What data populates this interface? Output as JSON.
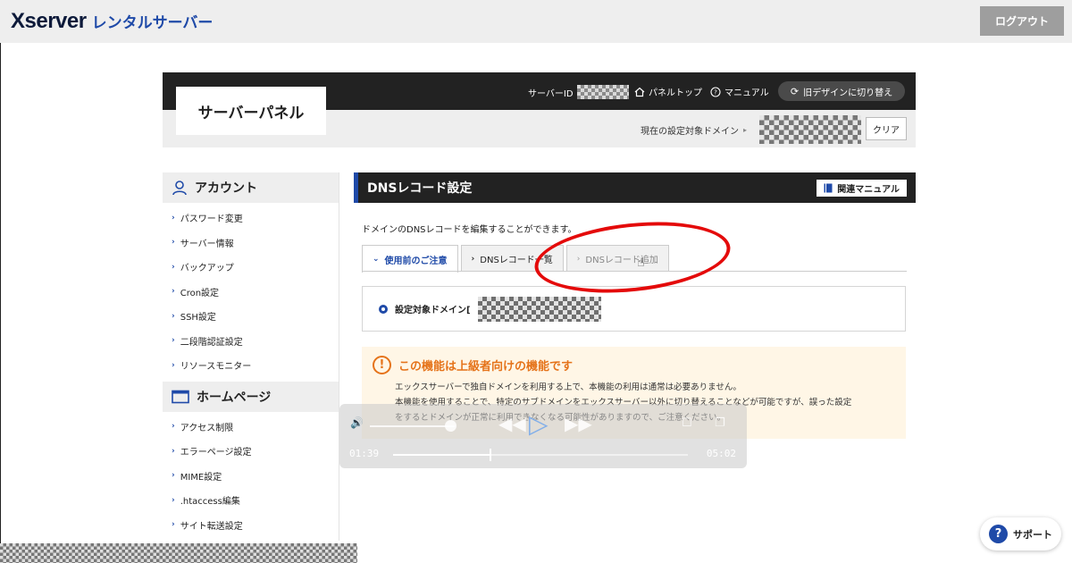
{
  "header": {
    "logo_text": "Xserver",
    "logo_sub": "レンタルサーバー",
    "logout_label": "ログアウト"
  },
  "panel": {
    "title": "サーバーパネル",
    "server_id_label": "サーバーID",
    "panel_top_label": "パネルトップ",
    "manual_label": "マニュアル",
    "old_design_label": "旧デザインに切り替え",
    "current_domain_label": "現在の設定対象ドメイン",
    "clear_label": "クリア"
  },
  "sidebar": {
    "account": {
      "heading": "アカウント",
      "items": [
        "パスワード変更",
        "サーバー情報",
        "バックアップ",
        "Cron設定",
        "SSH設定",
        "二段階認証設定",
        "リソースモニター"
      ]
    },
    "homepage": {
      "heading": "ホームページ",
      "items": [
        "アクセス制限",
        "エラーページ設定",
        "MIME設定",
        ".htaccess編集",
        "サイト転送設定"
      ]
    }
  },
  "main": {
    "title": "DNSレコード設定",
    "manual_button": "関連マニュアル",
    "description": "ドメインのDNSレコードを編集することができます。",
    "tabs": [
      {
        "label": "使用前のご注意",
        "state": "active"
      },
      {
        "label": "DNSレコード一覧",
        "state": "normal"
      },
      {
        "label": "DNSレコード追加",
        "state": "disabled"
      }
    ],
    "target_domain_label": "設定対象ドメイン[",
    "warning": {
      "title": "この機能は上級者向けの機能です",
      "line1": "エックスサーバーで独自ドメインを利用する上で、本機能の利用は通常は必要ありません。",
      "line2": "本機能を使用することで、特定のサブドメインをエックスサーバー以外に切り替えることなどが可能ですが、誤った設定",
      "line3": "をするとドメインが正常に利用できなくなる可能性がありますので、ご注意ください。"
    }
  },
  "player": {
    "current_time": "01:39",
    "total_time": "05:02",
    "progress": 0.33,
    "volume": 0.9
  },
  "support": {
    "label": "サポート"
  },
  "colors": {
    "brand_blue": "#1f4aa8",
    "dark_bar": "#222222",
    "warning_orange": "#e5731a",
    "annotation_red": "#e40a0a"
  }
}
